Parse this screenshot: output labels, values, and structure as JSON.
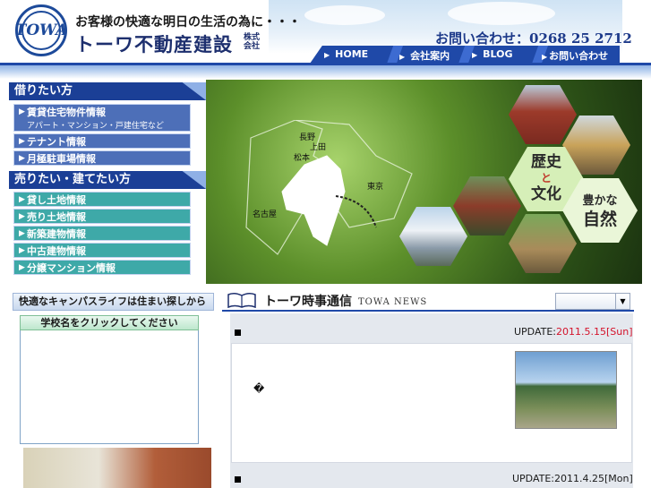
{
  "header": {
    "logo_text": "TOWA",
    "tagline": "お客様の快適な明日の生活の為に・・・",
    "company_name": "トーワ不動産建設",
    "company_suffix": "株式会社",
    "contact": "お問い合わせ：0268 25 2712"
  },
  "nav": {
    "items": [
      "HOME",
      "会社案内",
      "BLOG",
      "お問い合わせ"
    ]
  },
  "menu_rent": {
    "title": "借りたい方",
    "items": [
      {
        "label": "賃貸住宅物件情報",
        "sub": "アパート・マンション・戸建住宅など"
      },
      {
        "label": "テナント情報"
      },
      {
        "label": "月極駐車場情報"
      }
    ]
  },
  "menu_buy": {
    "title": "売りたい・建てたい方",
    "items": [
      "貸し土地情報",
      "売り土地情報",
      "新築建物情報",
      "中古建物情報",
      "分譲マンション情報"
    ]
  },
  "hero": {
    "map_labels": [
      "長野",
      "上田",
      "松本",
      "東京",
      "名古屋"
    ],
    "hex_history": [
      "歴史",
      "と",
      "文化"
    ],
    "hex_nature": [
      "豊かな",
      "自然"
    ]
  },
  "campus": {
    "header": "快適なキャンパスライフは住まい探しから",
    "button": "学校名をクリックしてください"
  },
  "news": {
    "title": "トーワ時事通信",
    "subtitle": "TOWA NEWS",
    "entries": [
      {
        "prefix": "UPDATE:",
        "date": "2011.5.15[Sun]",
        "body_glyph": "�"
      },
      {
        "prefix": "UPDATE:",
        "date": "2011.4.25[Mon]"
      }
    ]
  },
  "colors": {
    "brand_blue": "#1d4a9a",
    "nav_blue": "#1f49a8",
    "menu_blue": "#4d6fb8",
    "menu_teal": "#3ea9a8",
    "update_red": "#d4122a"
  }
}
